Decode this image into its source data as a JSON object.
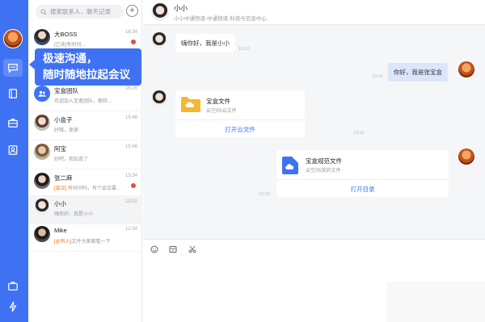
{
  "search": {
    "placeholder": "搜索联系人、聊天记录"
  },
  "promo": {
    "line1": "极速沟通，",
    "line2": "随时随地拉起会议"
  },
  "conversations": [
    {
      "name": "大BOSS",
      "preview": "[已读]有时间...",
      "time": "16:34",
      "unread": true
    },
    {
      "name": "",
      "preview": "",
      "time": ""
    },
    {
      "name": "宝盒团队",
      "preview": "欢迎加入宝盒团队，期待...",
      "time": "16:20"
    },
    {
      "name": "小盒子",
      "preview": "好哦，谢谢",
      "time": "15:46"
    },
    {
      "name": "阿宝",
      "preview": "好吧，我知道了",
      "time": "15:46"
    },
    {
      "name": "张二麻",
      "tag": "[会议]",
      "preview": "有时间吗，有个会议要...",
      "time": "13:34",
      "unread": true
    },
    {
      "name": "小小",
      "preview": "嗨你好，我是小小",
      "time": "13:02"
    },
    {
      "name": "Mike",
      "tag": "[@有人]",
      "preview": "文件大家都看一下",
      "time": "12:34"
    }
  ],
  "chat": {
    "title": "小小",
    "org": "小小中通快递-中通快递-科技与信息中心",
    "messages": [
      {
        "text": "嗨你好，我是小小",
        "time": "13:02"
      },
      {
        "text": "你好，我是张宝盒",
        "time": "13:02"
      }
    ],
    "file1": {
      "name": "宝盒文件",
      "path": "云空间/云文件",
      "action": "打开云文件",
      "time": "13:02"
    },
    "file2": {
      "name": "宝盒规范文件",
      "path": "云空间/我的文件",
      "action": "打开目录",
      "time": "13:02"
    }
  },
  "colors": {
    "brand": "#3f72f3",
    "unread": "#e84c3d",
    "folder": "#f5b731"
  },
  "icons": [
    "chat-icon",
    "book-icon",
    "toolbox-icon",
    "contact-icon",
    "briefcase-icon",
    "lightning-icon",
    "emoji-icon",
    "image-icon",
    "scissors-icon"
  ]
}
